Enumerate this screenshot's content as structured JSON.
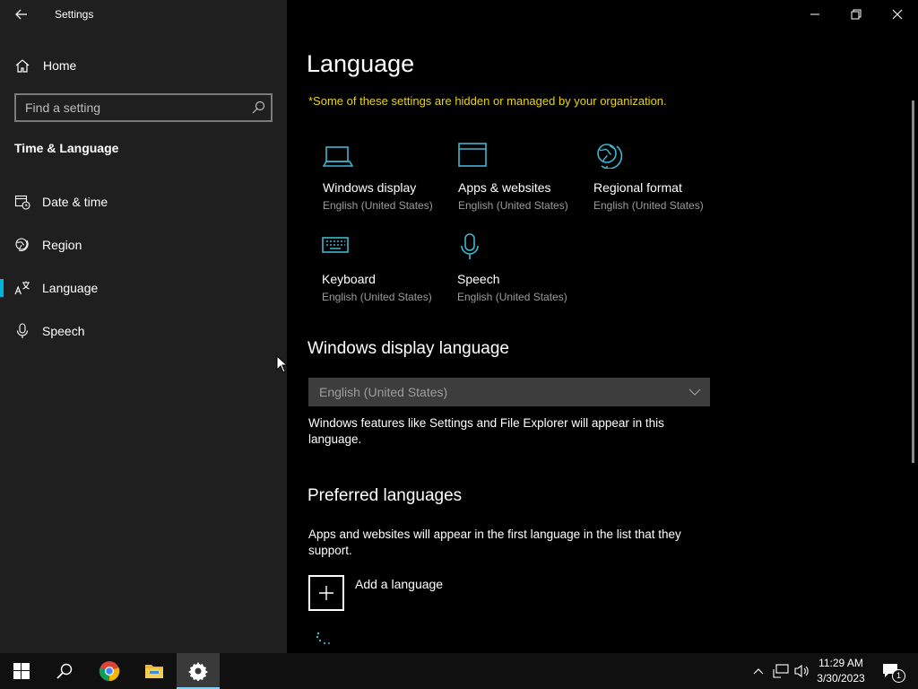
{
  "window": {
    "title": "Settings",
    "controls": {
      "minimize_icon": "minimize-icon",
      "restore_icon": "restore-icon",
      "close_icon": "close-icon"
    }
  },
  "sidebar": {
    "home_label": "Home",
    "search_placeholder": "Find a setting",
    "section_title": "Time & Language",
    "items": [
      {
        "label": "Date & time",
        "icon": "calendar-clock-icon",
        "selected": false
      },
      {
        "label": "Region",
        "icon": "globe-icon",
        "selected": false
      },
      {
        "label": "Language",
        "icon": "language-icon",
        "selected": true
      },
      {
        "label": "Speech",
        "icon": "microphone-icon",
        "selected": false
      }
    ]
  },
  "main": {
    "title": "Language",
    "org_note": "*Some of these settings are hidden or managed by your organization.",
    "tiles": [
      {
        "name": "Windows display",
        "sub": "English (United States)",
        "icon": "laptop-icon"
      },
      {
        "name": "Apps & websites",
        "sub": "English (United States)",
        "icon": "browser-window-icon"
      },
      {
        "name": "Regional format",
        "sub": "English (United States)",
        "icon": "globe-icon"
      },
      {
        "name": "Keyboard",
        "sub": "English (United States)",
        "icon": "keyboard-icon"
      },
      {
        "name": "Speech",
        "sub": "English (United States)",
        "icon": "microphone-icon"
      }
    ],
    "display_language": {
      "heading": "Windows display language",
      "selected": "English (United States)",
      "description": "Windows features like Settings and File Explorer will appear in this language."
    },
    "preferred": {
      "heading": "Preferred languages",
      "description": "Apps and websites will appear in the first language in the list that they support.",
      "add_label": "Add a language"
    }
  },
  "taskbar": {
    "time": "11:29 AM",
    "date": "3/30/2023",
    "notification_count": "1"
  },
  "colors": {
    "accent": "#00b4d8",
    "warning": "#e6d31a",
    "sidebar_bg": "#1f1f1f",
    "main_bg": "#000000"
  }
}
